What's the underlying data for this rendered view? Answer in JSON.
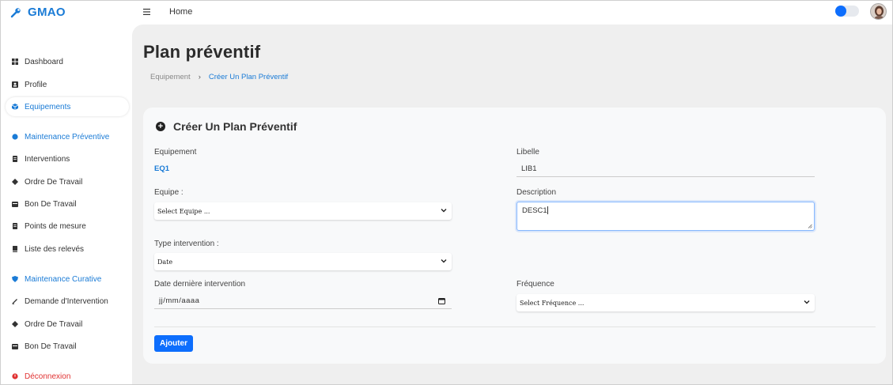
{
  "app": {
    "brand": "GMAO"
  },
  "header": {
    "menu_icon": "hamburger-icon",
    "home_label": "Home"
  },
  "sidebar": {
    "items": [
      {
        "label": "Dashboard",
        "icon": "dashboard-icon"
      },
      {
        "label": "Profile",
        "icon": "profile-icon"
      },
      {
        "label": "Equipements",
        "icon": "cube-icon"
      },
      {
        "label": "Maintenance Préventive",
        "icon": "dot-icon"
      },
      {
        "label": "Interventions",
        "icon": "document-icon"
      },
      {
        "label": "Ordre De Travail",
        "icon": "diamond-icon"
      },
      {
        "label": "Bon De Travail",
        "icon": "calendar-icon"
      },
      {
        "label": "Points de mesure",
        "icon": "document-icon"
      },
      {
        "label": "Liste des relevés",
        "icon": "book-icon"
      },
      {
        "label": "Maintenance Curative",
        "icon": "shield-icon"
      },
      {
        "label": "Demande d'Intervention",
        "icon": "pencil-icon"
      },
      {
        "label": "Ordre De Travail",
        "icon": "diamond-icon"
      },
      {
        "label": "Bon De Travail",
        "icon": "calendar-icon"
      },
      {
        "label": "Déconnexion",
        "icon": "logout-icon"
      }
    ]
  },
  "page": {
    "title": "Plan préventif",
    "breadcrumb": {
      "parent": "Equipement",
      "separator": "›",
      "current": "Créer Un Plan Préventif"
    }
  },
  "form": {
    "card_title": "Créer Un Plan Préventif",
    "equipement_label": "Equipement",
    "equipement_value": "EQ1",
    "libelle_label": "Libelle",
    "libelle_value": "LIB1",
    "equipe_label": "Equipe :",
    "equipe_select": "Select Equipe ...",
    "description_label": "Description",
    "description_value": "DESC1",
    "type_label": "Type intervention :",
    "type_select": "Date",
    "date_label": "Date dernière intervention",
    "date_placeholder": "jj/mm/aaaa",
    "frequence_label": "Fréquence",
    "frequence_select": "Select Fréquence ...",
    "submit_label": "Ajouter"
  },
  "colors": {
    "accent": "#1a7bd6",
    "button": "#0d6efd",
    "danger": "#e03131",
    "main_bg": "#efefef"
  }
}
